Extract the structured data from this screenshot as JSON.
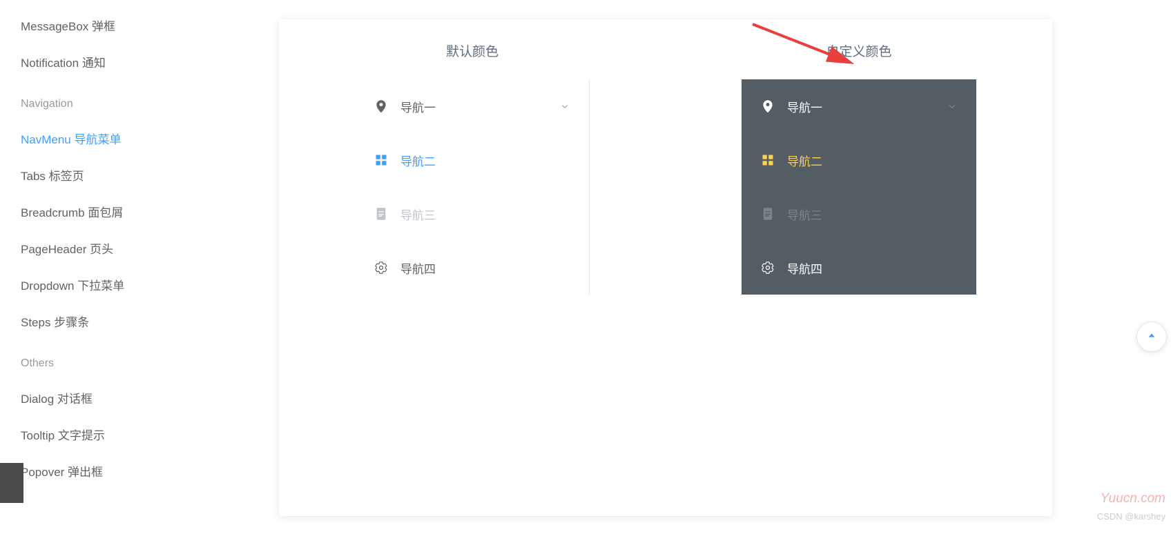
{
  "sidebar": {
    "items": [
      {
        "label": "MessageBox 弹框",
        "active": false
      },
      {
        "label": "Notification 通知",
        "active": false
      }
    ],
    "group_nav": "Navigation",
    "nav_items": [
      {
        "label": "NavMenu 导航菜单",
        "active": true
      },
      {
        "label": "Tabs 标签页",
        "active": false
      },
      {
        "label": "Breadcrumb 面包屑",
        "active": false
      },
      {
        "label": "PageHeader 页头",
        "active": false
      },
      {
        "label": "Dropdown 下拉菜单",
        "active": false
      },
      {
        "label": "Steps 步骤条",
        "active": false
      }
    ],
    "group_others": "Others",
    "others_items": [
      {
        "label": "Dialog 对话框",
        "active": false
      },
      {
        "label": "Tooltip 文字提示",
        "active": false
      },
      {
        "label": "Popover 弹出框",
        "active": false
      }
    ]
  },
  "columns": {
    "default_title": "默认颜色",
    "custom_title": "自定义颜色"
  },
  "menu": {
    "nav1": "导航一",
    "nav2": "导航二",
    "nav3": "导航三",
    "nav4": "导航四"
  },
  "watermark": {
    "site": "Yuucn.com",
    "csdn": "CSDN @karshey"
  },
  "colors": {
    "primary": "#409eff",
    "dark_bg": "#545c64",
    "dark_active": "#ffd04b",
    "arrow": "#e93f3f"
  }
}
